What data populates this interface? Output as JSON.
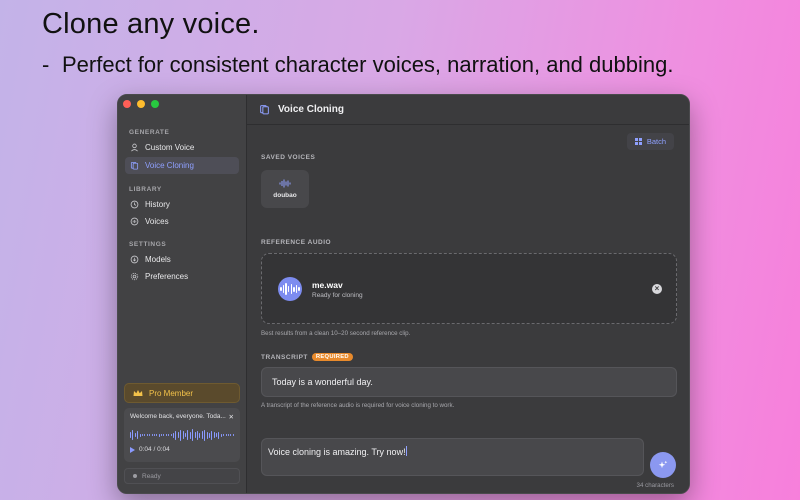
{
  "marketing": {
    "headline": "Clone any voice.",
    "dash": "-",
    "subline": "Perfect for consistent character voices, narration, and dubbing."
  },
  "sidebar": {
    "sections": {
      "generate": "GENERATE",
      "library": "LIBRARY",
      "settings": "SETTINGS"
    },
    "items": [
      {
        "label": "Custom Voice",
        "icon": "person-icon"
      },
      {
        "label": "Voice Cloning",
        "icon": "document-icon",
        "active": true
      },
      {
        "label": "History",
        "icon": "clock-icon"
      },
      {
        "label": "Voices",
        "icon": "voices-icon"
      },
      {
        "label": "Models",
        "icon": "download-icon"
      },
      {
        "label": "Preferences",
        "icon": "gear-icon"
      }
    ],
    "pro_label": "Pro Member",
    "player": {
      "title": "Welcome back, everyone. Toda...",
      "time": "0:04 / 0:04"
    },
    "status": "Ready"
  },
  "main": {
    "title": "Voice Cloning",
    "batch_label": "Batch",
    "saved_voices_label": "SAVED VOICES",
    "saved_voices": [
      {
        "name": "doubao"
      }
    ],
    "reference_label": "REFERENCE AUDIO",
    "reference_file": "me.wav",
    "reference_status": "Ready for cloning",
    "reference_hint": "Best results from a clean 10–20 second reference clip.",
    "transcript_label": "TRANSCRIPT",
    "required_badge": "REQUIRED",
    "transcript_value": "Today is a wonderful day.",
    "transcript_hint": "A transcript of the reference audio is required for voice cloning to work.",
    "generate_input_value": "Voice cloning is amazing. Try now!",
    "char_count": "34 characters"
  },
  "colors": {
    "accent": "#8fa0ff",
    "pro": "#f3c24a",
    "required": "#e88a2c"
  }
}
